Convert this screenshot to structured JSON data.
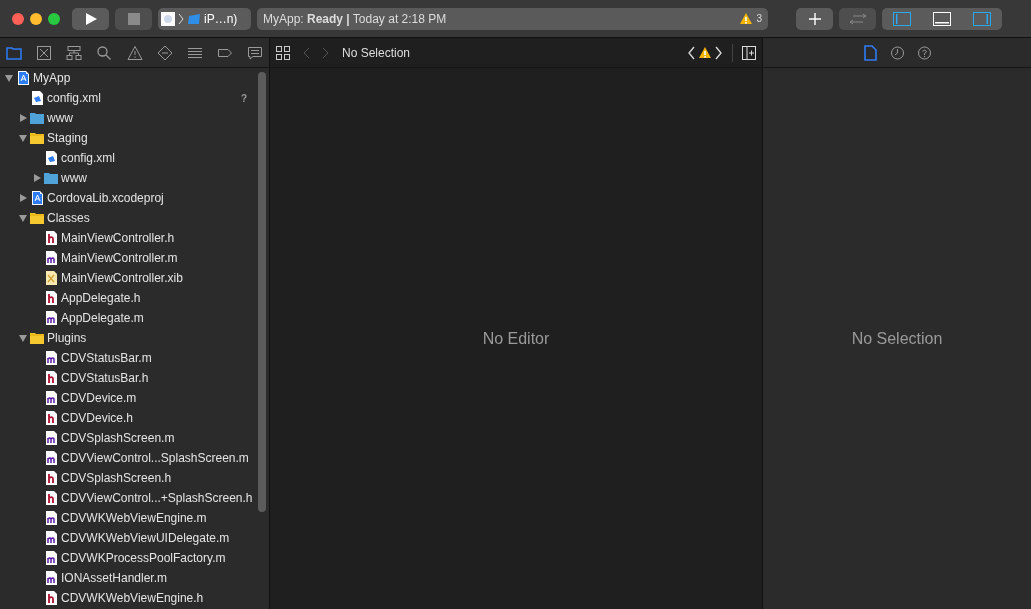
{
  "toolbar": {
    "scheme": {
      "label": "iP…n)"
    },
    "status": {
      "text": "MyApp: **Ready |** Today at 2:18 PM",
      "warning_count": "3"
    },
    "layout_toggles": [
      {
        "kind": "navigator",
        "on": true
      },
      {
        "kind": "debug",
        "on": false
      },
      {
        "kind": "inspector",
        "on": true
      }
    ]
  },
  "navigator_tabs": [
    {
      "kind": "folder",
      "selected": true
    },
    {
      "kind": "source-control",
      "selected": false
    },
    {
      "kind": "hierarchy",
      "selected": false
    },
    {
      "kind": "search",
      "selected": false
    },
    {
      "kind": "warning",
      "selected": false
    },
    {
      "kind": "test",
      "selected": false
    },
    {
      "kind": "debug",
      "selected": false
    },
    {
      "kind": "breakpoint",
      "selected": false
    },
    {
      "kind": "report",
      "selected": false
    }
  ],
  "tree": [
    {
      "name": "MyApp",
      "kind": "project",
      "expanded": true,
      "children": [
        {
          "name": "config.xml",
          "kind": "xml",
          "status": "?"
        },
        {
          "name": "www",
          "kind": "blue-folder",
          "expanded": false
        },
        {
          "name": "Staging",
          "kind": "yellow-folder",
          "expanded": true,
          "children": [
            {
              "name": "config.xml",
              "kind": "xml"
            },
            {
              "name": "www",
              "kind": "blue-folder",
              "expanded": false
            }
          ]
        },
        {
          "name": "CordovaLib.xcodeproj",
          "kind": "project",
          "expanded": false
        },
        {
          "name": "Classes",
          "kind": "yellow-folder",
          "expanded": true,
          "children": [
            {
              "name": "MainViewController.h",
              "kind": "h"
            },
            {
              "name": "MainViewController.m",
              "kind": "m"
            },
            {
              "name": "MainViewController.xib",
              "kind": "xib"
            },
            {
              "name": "AppDelegate.h",
              "kind": "h"
            },
            {
              "name": "AppDelegate.m",
              "kind": "m"
            }
          ]
        },
        {
          "name": "Plugins",
          "kind": "yellow-folder",
          "expanded": true,
          "children": [
            {
              "name": "CDVStatusBar.m",
              "kind": "m"
            },
            {
              "name": "CDVStatusBar.h",
              "kind": "h"
            },
            {
              "name": "CDVDevice.m",
              "kind": "m"
            },
            {
              "name": "CDVDevice.h",
              "kind": "h"
            },
            {
              "name": "CDVSplashScreen.m",
              "kind": "m"
            },
            {
              "name": "CDVViewControl...SplashScreen.m",
              "kind": "m"
            },
            {
              "name": "CDVSplashScreen.h",
              "kind": "h"
            },
            {
              "name": "CDVViewControl...+SplashScreen.h",
              "kind": "h"
            },
            {
              "name": "CDVWKWebViewEngine.m",
              "kind": "m"
            },
            {
              "name": "CDVWKWebViewUIDelegate.m",
              "kind": "m"
            },
            {
              "name": "CDVWKProcessPoolFactory.m",
              "kind": "m"
            },
            {
              "name": "IONAssetHandler.m",
              "kind": "m"
            },
            {
              "name": "CDVWKWebViewEngine.h",
              "kind": "h"
            }
          ]
        }
      ]
    }
  ],
  "editor": {
    "jump_bar": "No Selection",
    "placeholder": "No Editor"
  },
  "inspector": {
    "tabs": [
      {
        "kind": "file",
        "selected": true
      },
      {
        "kind": "history",
        "selected": false
      },
      {
        "kind": "help",
        "selected": false
      }
    ],
    "placeholder": "No Selection"
  }
}
